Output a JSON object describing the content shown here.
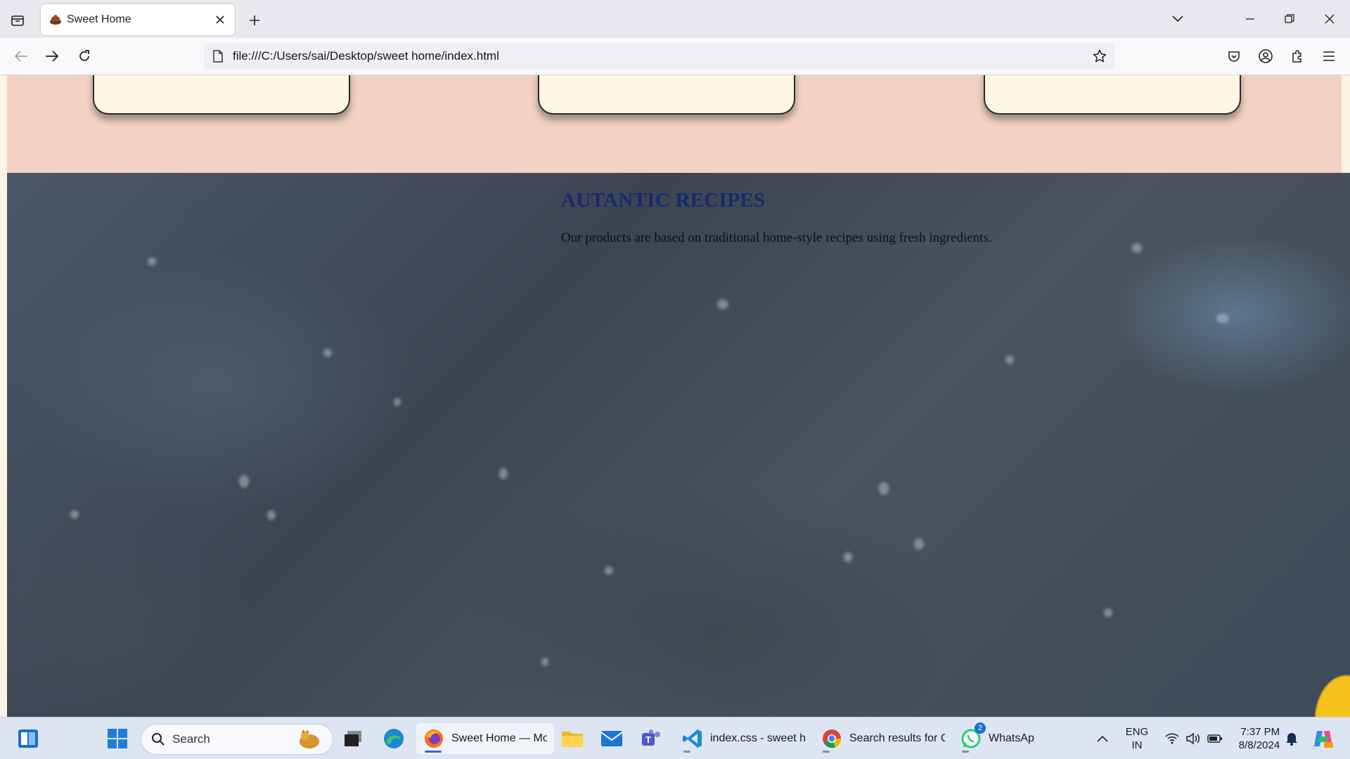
{
  "browser": {
    "tab": {
      "title": "Sweet Home"
    },
    "url": "file:///C:/Users/sai/Desktop/sweet home/index.html"
  },
  "page": {
    "recipes": {
      "heading": "AUTANTIC RECIPES",
      "text": "Our products are based on traditional home-style recipes using fresh ingredients."
    }
  },
  "taskbar": {
    "search_placeholder": "Search",
    "apps": [
      {
        "label": "Sweet Home — Mozilla Firefox",
        "icon": "firefox-icon"
      },
      {
        "label": "index.css - sweet home",
        "icon": "vscode-icon"
      },
      {
        "label": "Search results for Co",
        "icon": "chrome-icon"
      },
      {
        "label": "WhatsApp",
        "icon": "whatsapp-icon",
        "badge": "2"
      }
    ],
    "language": {
      "line1": "ENG",
      "line2": "IN"
    },
    "clock": {
      "time": "7:37 PM",
      "date": "8/8/2024"
    }
  },
  "colors": {
    "peach_section": "#f3d2c3",
    "card": "#fef7e6",
    "heading": "#162a6e",
    "taskbar": "#dde5f2"
  }
}
